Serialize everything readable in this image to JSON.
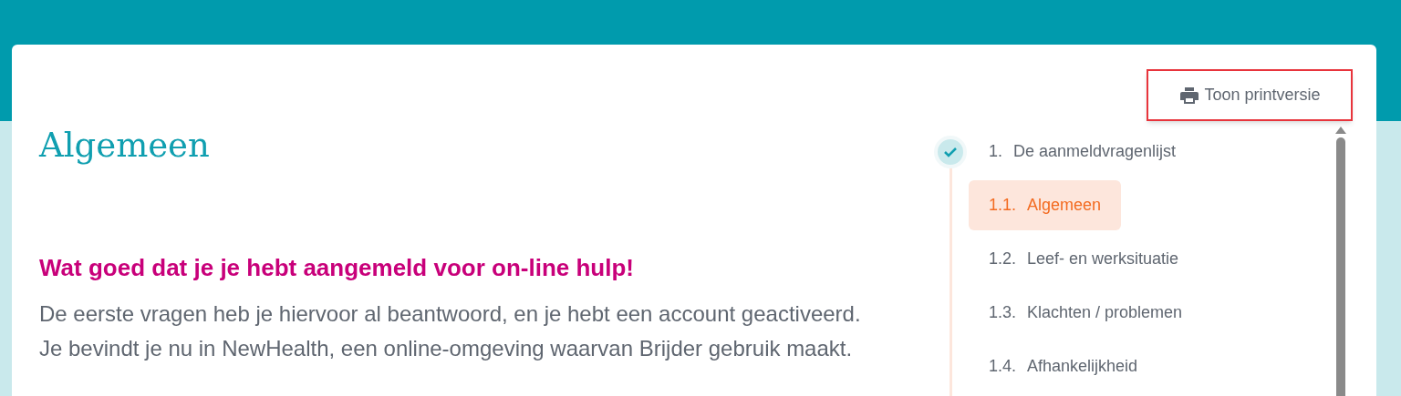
{
  "print_button": {
    "label": "Toon printversie",
    "highlighted": true
  },
  "page_title": "Algemeen",
  "heading": "Wat goed dat je je hebt aangemeld voor on-line hulp!",
  "paragraph_lines": [
    "De eerste vragen heb je hiervoor al beantwoord, en je hebt een account geactiveerd.",
    "Je bevindt je nu in NewHealth, een online-omgeving waarvan Brijder gebruik maakt."
  ],
  "steps": [
    {
      "number": "1.",
      "label": "De aanmeldvragenlijst",
      "completed": true,
      "selected": false,
      "children": [
        {
          "number": "1.1.",
          "label": "Algemeen",
          "selected": true
        },
        {
          "number": "1.2.",
          "label": "Leef- en werksituatie",
          "selected": false
        },
        {
          "number": "1.3.",
          "label": "Klachten / problemen",
          "selected": false
        },
        {
          "number": "1.4.",
          "label": "Afhankelijkheid",
          "selected": false
        }
      ]
    }
  ]
}
